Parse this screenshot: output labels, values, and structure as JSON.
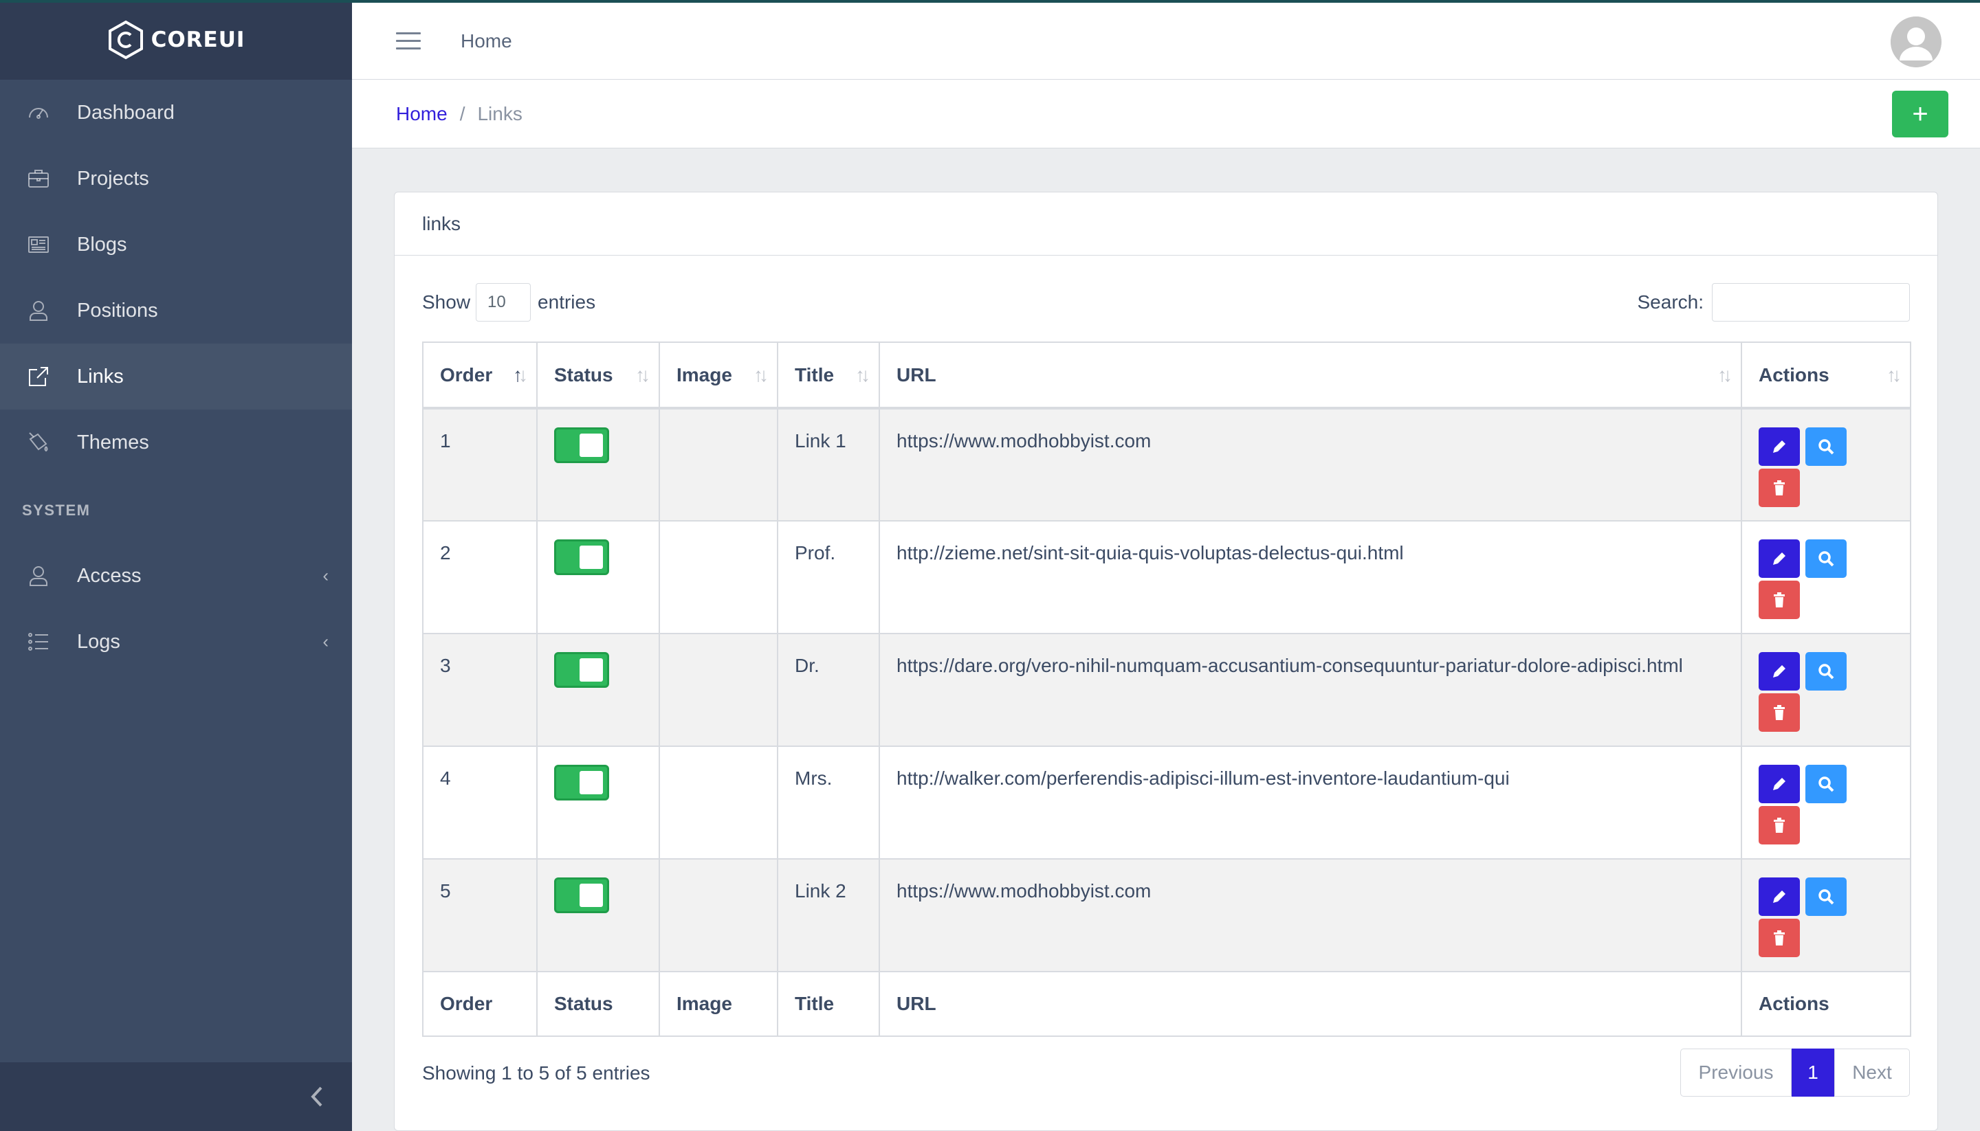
{
  "brand": {
    "name": "COREUI"
  },
  "sidebar": {
    "items": [
      {
        "label": "Dashboard",
        "icon": "speedometer-icon"
      },
      {
        "label": "Projects",
        "icon": "briefcase-icon"
      },
      {
        "label": "Blogs",
        "icon": "newspaper-icon"
      },
      {
        "label": "Positions",
        "icon": "user-icon"
      },
      {
        "label": "Links",
        "icon": "external-link-icon",
        "active": true
      },
      {
        "label": "Themes",
        "icon": "paint-bucket-icon"
      }
    ],
    "section_title": "SYSTEM",
    "system_items": [
      {
        "label": "Access",
        "icon": "user-icon"
      },
      {
        "label": "Logs",
        "icon": "list-icon"
      }
    ]
  },
  "header": {
    "home": "Home"
  },
  "breadcrumb": {
    "home": "Home",
    "sep": "/",
    "current": "Links"
  },
  "add_button": {
    "label": "+"
  },
  "card": {
    "title": "links",
    "show_label": "Show",
    "entries_label": "entries",
    "page_length": "10",
    "search_label": "Search:",
    "search_value": ""
  },
  "table": {
    "columns": [
      "Order",
      "Status",
      "Image",
      "Title",
      "URL",
      "Actions"
    ],
    "rows": [
      {
        "order": "1",
        "status": true,
        "title": "Link 1",
        "url": "https://www.modhobbyist.com"
      },
      {
        "order": "2",
        "status": true,
        "title": "Prof.",
        "url": "http://zieme.net/sint-sit-quia-quis-voluptas-delectus-qui.html"
      },
      {
        "order": "3",
        "status": true,
        "title": "Dr.",
        "url": "https://dare.org/vero-nihil-numquam-accusantium-consequuntur-pariatur-dolore-adipisci.html"
      },
      {
        "order": "4",
        "status": true,
        "title": "Mrs.",
        "url": "http://walker.com/perferendis-adipisci-illum-est-inventore-laudantium-qui"
      },
      {
        "order": "5",
        "status": true,
        "title": "Link 2",
        "url": "https://www.modhobbyist.com"
      }
    ]
  },
  "info": "Showing 1 to 5 of 5 entries",
  "pagination": {
    "previous": "Previous",
    "current": "1",
    "next": "Next"
  },
  "colors": {
    "primary": "#321fdb",
    "success": "#2eb85c",
    "info": "#39f",
    "danger": "#e55353",
    "sidebar": "#3c4b64"
  }
}
